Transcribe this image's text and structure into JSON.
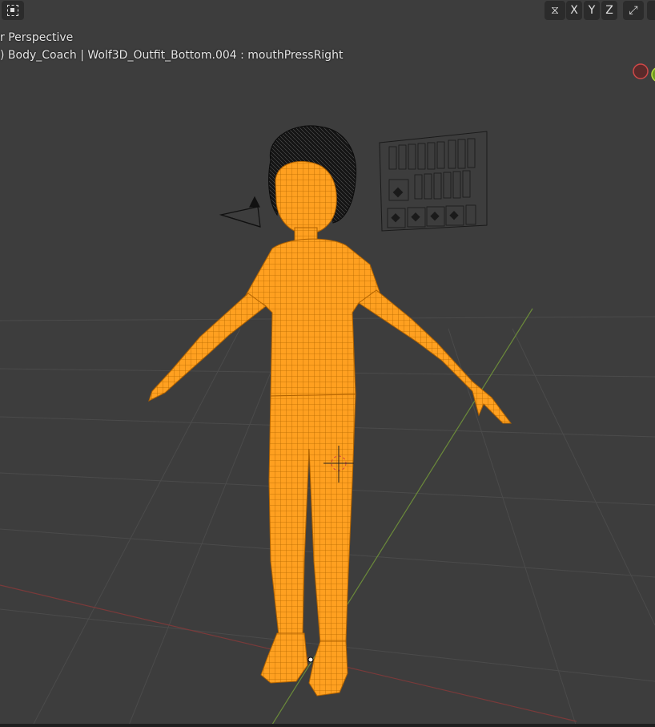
{
  "viewport": {
    "view_name": "r Perspective",
    "object_info": ") Body_Coach | Wolf3D_Outfit_Bottom.004 : mouthPressRight"
  },
  "header": {
    "select_icon": "select-box-icon",
    "gizmo_icon": "mirror-gizmo-icon",
    "axis_x": "X",
    "axis_y": "Y",
    "axis_z": "Z",
    "snap_icon": "snap-icon"
  },
  "colors": {
    "background": "#3d3d3d",
    "grid": "#4a4a4a",
    "selection": "#ff9d1c",
    "wire": "#b86a00",
    "x_axis": "#7a3a3a",
    "y_axis": "#6b8a3a"
  }
}
